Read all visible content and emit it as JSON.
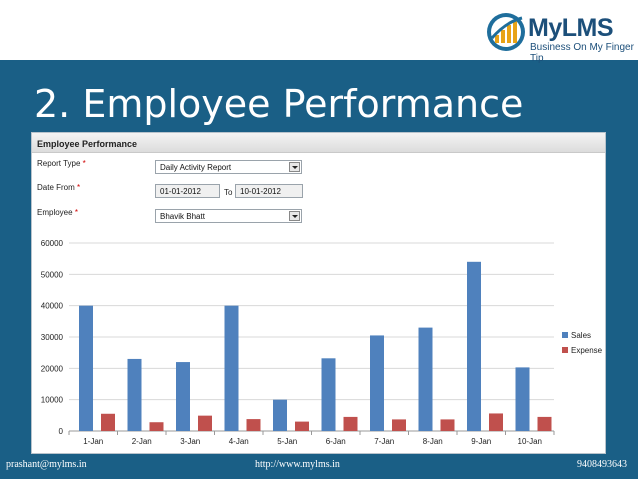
{
  "brand": {
    "name": "MyLMS",
    "tagline": "Business On My Finger Tip"
  },
  "slide_title": "2. Employee Performance",
  "panel": {
    "header": "Employee Performance",
    "report_type_label": "Report Type",
    "report_type_value": "Daily Activity Report",
    "date_from_label": "Date From",
    "date_from_value": "01-01-2012",
    "to_label": "To",
    "date_to_value": "10-01-2012",
    "employee_label": "Employee",
    "employee_value": "Bhavik Bhatt",
    "required_mark": "*"
  },
  "chart_data": {
    "type": "bar",
    "categories": [
      "1-Jan",
      "2-Jan",
      "3-Jan",
      "4-Jan",
      "5-Jan",
      "6-Jan",
      "7-Jan",
      "8-Jan",
      "9-Jan",
      "10-Jan"
    ],
    "series": [
      {
        "name": "Sales",
        "color": "#4f81bd",
        "values": [
          40000,
          23000,
          22000,
          40000,
          10000,
          23200,
          30500,
          33000,
          54000,
          20300
        ]
      },
      {
        "name": "Expense",
        "color": "#c0504d",
        "values": [
          5500,
          2800,
          4900,
          3800,
          3000,
          4500,
          3700,
          3700,
          5600,
          4500
        ]
      }
    ],
    "y_ticks": [
      "0",
      "10000",
      "20000",
      "30000",
      "40000",
      "50000",
      "60000"
    ],
    "ylim": [
      0,
      60000
    ],
    "grid": true,
    "legend_position": "right"
  },
  "footer": {
    "email": "prashant@mylms.in",
    "url": "http://www.mylms.in",
    "phone": "9408493643"
  }
}
